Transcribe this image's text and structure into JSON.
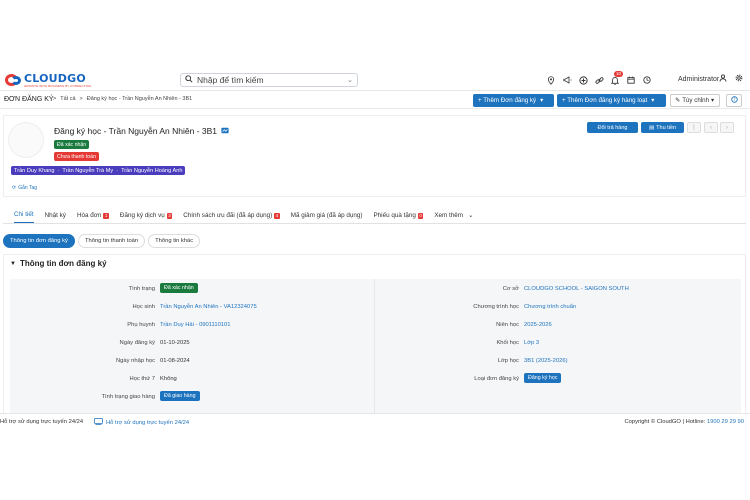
{
  "header": {
    "brand": "CLOUDGO",
    "slogan": "GROWTH WITH BUSINESS BY CONNECTING",
    "search_placeholder": "Nhập để tìm kiếm",
    "notification_count": "10",
    "user_name": "Administrator"
  },
  "breadcrumb": {
    "module": "ĐƠN ĐĂNG KÝ",
    "all": "Tất cả",
    "parent": "Đăng ký học - Trần Nguyễn An Nhiên - 3B1",
    "sep": ">"
  },
  "toolbar": {
    "add_label": "+ Thêm Đơn đăng ký",
    "add_bulk_label": "+ Thêm Đơn đăng ký hàng loạt",
    "customize_label": "Tùy chỉnh",
    "caret": "▾"
  },
  "record": {
    "title": "Đăng ký học - Trần Nguyễn An Nhiên - 3B1",
    "status_confirmed": "Đã xác nhận",
    "status_unpaid": "Chưa thanh toán",
    "related_people": [
      "Trần Duy Khang",
      "Trần Nguyễn Trà My",
      "Trần Nguyễn Hoàng Anh"
    ],
    "tag_label": "Gắn Tag",
    "btn_return": "Đổi trả hàng",
    "btn_collect": "Thu tiền"
  },
  "tabs": [
    {
      "label": "Chi tiết",
      "count": ""
    },
    {
      "label": "Nhật ký",
      "count": ""
    },
    {
      "label": "Hóa đơn",
      "count": "1"
    },
    {
      "label": "Đăng ký dịch vụ",
      "count": "3"
    },
    {
      "label": "Chính sách ưu đãi (đã áp dụng)",
      "count": "4"
    },
    {
      "label": "Mã giảm giá (đã áp dụng)",
      "count": ""
    },
    {
      "label": "Phiếu quà tặng",
      "count": "0"
    },
    {
      "label": "Xem thêm",
      "count": ""
    }
  ],
  "subtabs": [
    "Thông tin đơn đăng ký",
    "Thông tin thanh toán",
    "Thông tin khác"
  ],
  "section": {
    "title": "Thông tin đơn đăng ký",
    "left": [
      {
        "label": "Tình trạng",
        "value": "Đã xác nhận"
      },
      {
        "label": "Học sinh",
        "value": "Trần Nguyễn An Nhiên - VA12324075"
      },
      {
        "label": "Phụ huynh",
        "value": "Trần Duy Hải - 0901110101"
      },
      {
        "label": "Ngày đăng ký",
        "value": "01-10-2025"
      },
      {
        "label": "Ngày nhập học",
        "value": "01-08-2024"
      },
      {
        "label": "Học thứ 7",
        "value": "Không"
      },
      {
        "label": "Tình trạng giao hàng",
        "value": "Đã giao hàng"
      }
    ],
    "right": [
      {
        "label": "Cơ sở",
        "value": "CLOUDGO SCHOOL - SAIGON SOUTH"
      },
      {
        "label": "Chương trình học",
        "value": "Chương trình chuẩn"
      },
      {
        "label": "Niên học",
        "value": "2025-2026"
      },
      {
        "label": "Khối học",
        "value": "Lớp 3"
      },
      {
        "label": "Lớp học",
        "value": "3B1 (2025-2026)"
      },
      {
        "label": "Loại đơn đăng ký",
        "value": "Đăng ký học"
      }
    ]
  },
  "footer": {
    "support_left": "Hỗ trợ sử dụng trực tuyến 24/24",
    "support_link": "Hỗ trợ sử dụng trực tuyến 24/24",
    "copyright": "Copyright © CloudGO | Hotline: ",
    "hotline": "1900 29 29 90"
  },
  "colors": {
    "primary": "#1e73be",
    "success": "#1b7a3e",
    "danger": "#e53935",
    "purple": "#4a3dbd"
  }
}
